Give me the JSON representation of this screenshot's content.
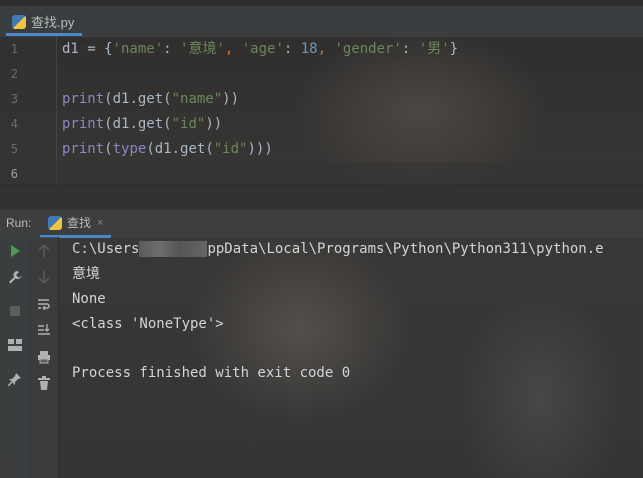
{
  "editor": {
    "tab_title": "查找.py",
    "line_numbers": [
      "1",
      "2",
      "3",
      "4",
      "5",
      "6"
    ],
    "lines": [
      [
        {
          "t": "d1 = {",
          "c": ""
        },
        {
          "t": "'name'",
          "c": "str"
        },
        {
          "t": ": ",
          "c": ""
        },
        {
          "t": "'意境'",
          "c": "str"
        },
        {
          "t": ", ",
          "c": "op"
        },
        {
          "t": "'age'",
          "c": "str"
        },
        {
          "t": ": ",
          "c": ""
        },
        {
          "t": "18",
          "c": "num"
        },
        {
          "t": ", ",
          "c": "op"
        },
        {
          "t": "'gender'",
          "c": "str"
        },
        {
          "t": ": ",
          "c": ""
        },
        {
          "t": "'男'",
          "c": "str"
        },
        {
          "t": "}",
          "c": ""
        }
      ],
      [],
      [
        {
          "t": "print",
          "c": "kw"
        },
        {
          "t": "(d1.get(",
          "c": ""
        },
        {
          "t": "\"name\"",
          "c": "str"
        },
        {
          "t": "))",
          "c": ""
        }
      ],
      [
        {
          "t": "print",
          "c": "kw"
        },
        {
          "t": "(d1.get(",
          "c": ""
        },
        {
          "t": "\"id\"",
          "c": "str"
        },
        {
          "t": "))",
          "c": ""
        }
      ],
      [
        {
          "t": "print",
          "c": "kw"
        },
        {
          "t": "(",
          "c": ""
        },
        {
          "t": "type",
          "c": "kw"
        },
        {
          "t": "(d1.get(",
          "c": ""
        },
        {
          "t": "\"id\"",
          "c": "str"
        },
        {
          "t": ")))",
          "c": ""
        }
      ],
      []
    ]
  },
  "run": {
    "label": "Run:",
    "tab_title": "查找",
    "close": "×",
    "console": {
      "path_prefix": "C:\\Users",
      "path_suffix": "ppData\\Local\\Programs\\Python\\Python311\\python.e",
      "output": [
        "意境",
        "None",
        "<class 'NoneType'>"
      ],
      "exit_message": "Process finished with exit code 0"
    }
  },
  "icons": {
    "run": "run-icon",
    "wrench": "wrench-icon",
    "stop": "stop-icon",
    "layout": "layout-icon",
    "pin": "pin-icon",
    "up": "arrow-up-icon",
    "down": "arrow-down-icon",
    "soft_wrap": "soft-wrap-icon",
    "scroll_end": "scroll-to-end-icon",
    "print": "print-icon",
    "trash": "trash-icon"
  },
  "colors": {
    "accent": "#4a88c7",
    "run_green": "#499c54",
    "string": "#6a8759",
    "number": "#6897bb",
    "builtin": "#8888c6"
  }
}
